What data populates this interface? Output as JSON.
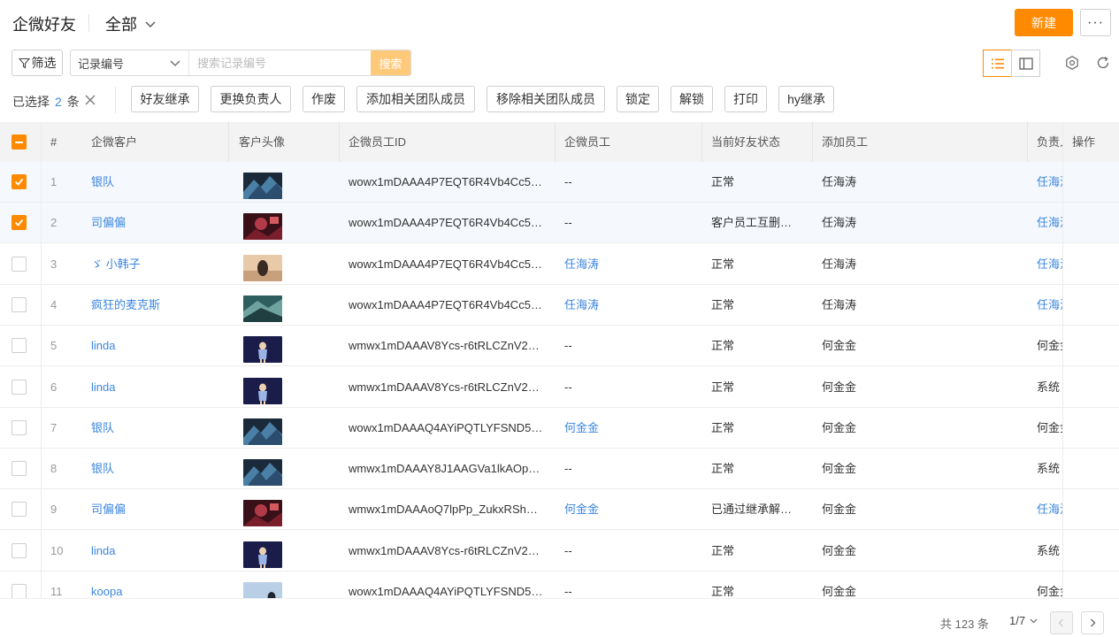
{
  "header": {
    "title": "企微好友",
    "view_label": "全部",
    "new_button": "新建",
    "more_button": "···"
  },
  "filter": {
    "filter_button": "筛选",
    "field_selected": "记录编号",
    "search_placeholder": "搜索记录编号",
    "search_button": "搜索"
  },
  "batch": {
    "selected_prefix": "已选择",
    "selected_count": "2",
    "selected_suffix": "条",
    "actions": [
      "好友继承",
      "更换负责人",
      "作废",
      "添加相关团队成员",
      "移除相关团队成员",
      "锁定",
      "解锁",
      "打印",
      "hy继承"
    ]
  },
  "table": {
    "columns": [
      "#",
      "企微客户",
      "客户头像",
      "企微员工ID",
      "企微员工",
      "当前好友状态",
      "添加员工",
      "负责人",
      "操作"
    ],
    "rows": [
      {
        "index": "1",
        "customer": "银队",
        "avatar": "dark-blue",
        "employee_id": "wowx1mDAAA4P7EQT6R4Vb4Cc5…",
        "employee": "--",
        "status": "正常",
        "adder": "任海涛",
        "owner": "任海涛",
        "selected": true
      },
      {
        "index": "2",
        "customer": "司偏偏",
        "avatar": "red",
        "employee_id": "wowx1mDAAA4P7EQT6R4Vb4Cc5…",
        "employee": "--",
        "status": "客户员工互删…",
        "adder": "任海涛",
        "owner": "任海涛",
        "selected": true
      },
      {
        "index": "3",
        "customer": "ゞ 小韩子",
        "avatar": "sunset",
        "employee_id": "wowx1mDAAA4P7EQT6R4Vb4Cc5…",
        "employee": "任海涛",
        "status": "正常",
        "adder": "任海涛",
        "owner": "任海涛",
        "selected": false
      },
      {
        "index": "4",
        "customer": "疯狂的麦克斯",
        "avatar": "teal",
        "employee_id": "wowx1mDAAA4P7EQT6R4Vb4Cc5…",
        "employee": "任海涛",
        "status": "正常",
        "adder": "任海涛",
        "owner": "任海涛",
        "selected": false
      },
      {
        "index": "5",
        "customer": "linda",
        "avatar": "navy",
        "employee_id": "wmwx1mDAAAV8Ycs-r6tRLCZnV2…",
        "employee": "--",
        "status": "正常",
        "adder": "何金金",
        "owner": "何金金",
        "selected": false
      },
      {
        "index": "6",
        "customer": "linda",
        "avatar": "navy",
        "employee_id": "wmwx1mDAAAV8Ycs-r6tRLCZnV2…",
        "employee": "--",
        "status": "正常",
        "adder": "何金金",
        "owner": "系统",
        "selected": false
      },
      {
        "index": "7",
        "customer": "银队",
        "avatar": "dark-blue",
        "employee_id": "wowx1mDAAAQ4AYiPQTLYFSND5…",
        "employee": "何金金",
        "status": "正常",
        "adder": "何金金",
        "owner": "何金金",
        "selected": false
      },
      {
        "index": "8",
        "customer": "银队",
        "avatar": "dark-blue",
        "employee_id": "wmwx1mDAAAY8J1AAGVa1lkAOp…",
        "employee": "--",
        "status": "正常",
        "adder": "何金金",
        "owner": "系统",
        "selected": false
      },
      {
        "index": "9",
        "customer": "司偏偏",
        "avatar": "red",
        "employee_id": "wmwx1mDAAAoQ7lpPp_ZukxRSh…",
        "employee": "何金金",
        "status": "已通过继承解…",
        "adder": "何金金",
        "owner": "任海涛",
        "selected": false
      },
      {
        "index": "10",
        "customer": "linda",
        "avatar": "navy",
        "employee_id": "wmwx1mDAAAV8Ycs-r6tRLCZnV2…",
        "employee": "--",
        "status": "正常",
        "adder": "何金金",
        "owner": "系统",
        "selected": false
      },
      {
        "index": "11",
        "customer": "koopa",
        "avatar": "sky",
        "employee_id": "wowx1mDAAAQ4AYiPQTLYFSND5…",
        "employee": "--",
        "status": "正常",
        "adder": "何金金",
        "owner": "何金金",
        "selected": false
      }
    ]
  },
  "pagination": {
    "total": "共 123 条",
    "page": "1/7"
  },
  "colors": {
    "accent": "#ff8a00",
    "link": "#3b86e0"
  }
}
